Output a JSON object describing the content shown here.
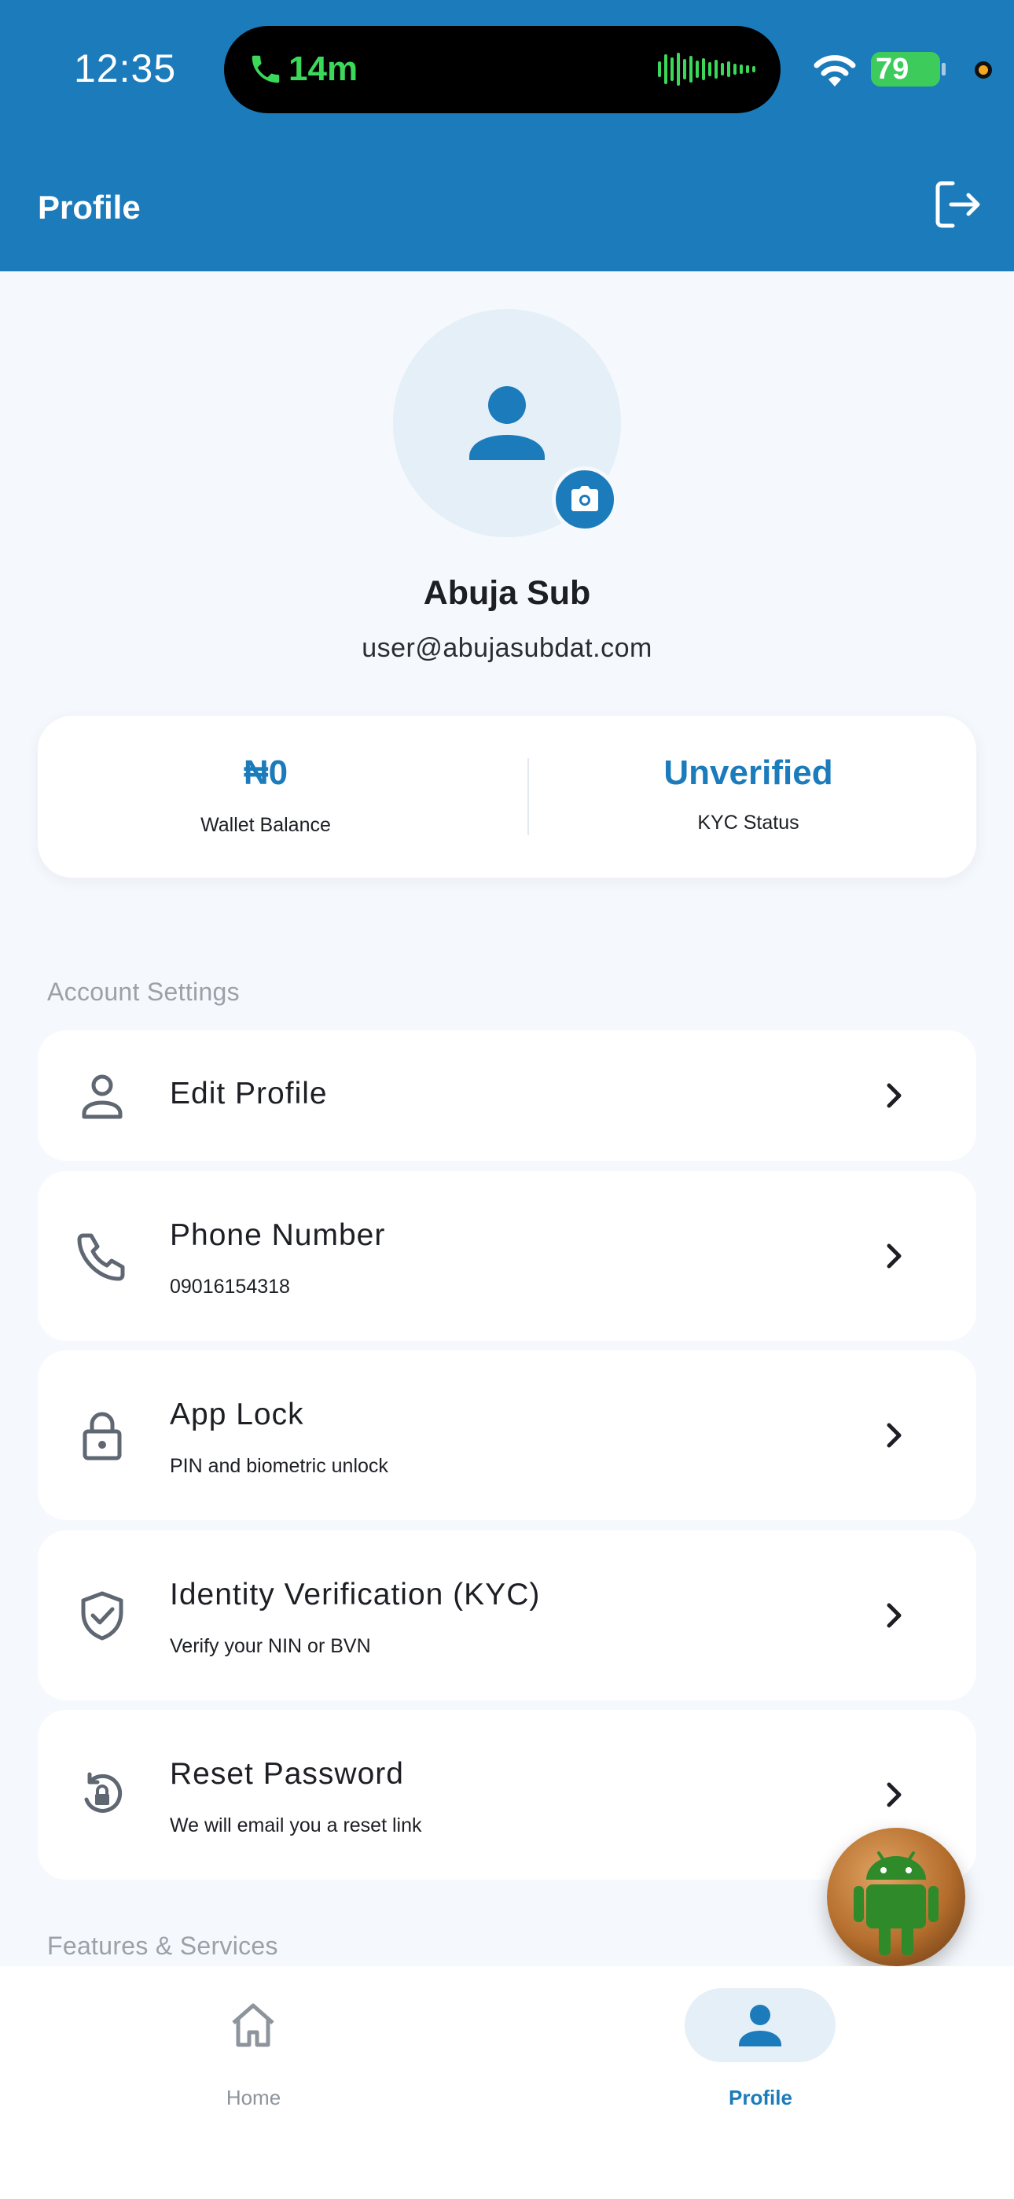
{
  "status_bar": {
    "time": "12:35",
    "call_duration": "14m",
    "battery": "79"
  },
  "app_bar": {
    "title": "Profile"
  },
  "profile": {
    "name": "Abuja Sub",
    "email": "user@abujasubdat.com"
  },
  "stats": {
    "wallet_value": "₦0",
    "wallet_label": "Wallet Balance",
    "kyc_value": "Unverified",
    "kyc_label": "KYC Status"
  },
  "sections": {
    "account_settings": "Account Settings",
    "features_services": "Features & Services"
  },
  "settings": [
    {
      "title": "Edit Profile",
      "subtitle": "",
      "icon": "person-outline-icon"
    },
    {
      "title": "Phone Number",
      "subtitle": "09016154318",
      "icon": "phone-icon"
    },
    {
      "title": "App Lock",
      "subtitle": "PIN and biometric unlock",
      "icon": "lock-icon"
    },
    {
      "title": "Identity Verification (KYC)",
      "subtitle": "Verify your NIN or BVN",
      "icon": "shield-check-icon"
    },
    {
      "title": "Reset Password",
      "subtitle": "We will email you a reset link",
      "icon": "lock-reset-icon"
    }
  ],
  "bottom_nav": {
    "home": "Home",
    "profile": "Profile",
    "active": "profile"
  },
  "colors": {
    "primary": "#1b7bbb",
    "background": "#f5f8fc",
    "avatar_bg": "#e4eff8",
    "call_green": "#3bd85a"
  }
}
